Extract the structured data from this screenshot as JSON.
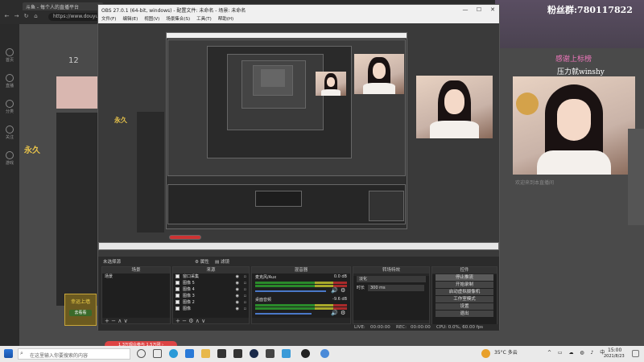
{
  "browser": {
    "tab_title": "斗鱼 - 每个人的直播平台",
    "address": "https://www.douyu.com"
  },
  "stream_page": {
    "fans_group": "粉丝群:780117822",
    "thanks_line": "感谢上标榜",
    "thanks_user": "压力就winshy",
    "viewer_count": "12",
    "left_badge": "永久",
    "left_rail": [
      "首页",
      "直播",
      "分类",
      "关注",
      "游戏"
    ],
    "sticker_label": "幸运上墙",
    "sticker_button": "去看看",
    "bottom_pill": "1.3万观众参与  1.5万团 ›",
    "side_note": "欢迎来到本直播间"
  },
  "obs": {
    "title": "OBS 27.0.1 (64-bit, windows) - 配置文件: 未命名 - 场景: 未命名",
    "window_controls": [
      "—",
      "☐",
      "✕"
    ],
    "menu": [
      "文件(F)",
      "编辑(E)",
      "视图(V)",
      "场景集合(S)",
      "工具(T)",
      "帮助(H)"
    ],
    "scene_bar": {
      "label": "未选择源",
      "properties": "属性",
      "filters": "滤镜"
    },
    "docks": {
      "scenes": {
        "title": "场景",
        "items": [
          "场景"
        ]
      },
      "sources": {
        "title": "来源",
        "items": [
          "窗口采集",
          "图像 5",
          "图像 4",
          "图像 3",
          "图像 2",
          "图像"
        ]
      },
      "mixer": {
        "title": "混音器",
        "tracks": [
          {
            "name": "麦克风/Aux",
            "db": "0.0 dB"
          },
          {
            "name": "桌面音频",
            "db": "-9.6 dB"
          }
        ]
      },
      "transitions": {
        "title": "转场特效",
        "type": "淡化",
        "duration_label": "时长",
        "duration": "300 ms"
      },
      "controls": {
        "title": "控件",
        "buttons": [
          "停止推流",
          "开始录制",
          "启动虚拟摄像机",
          "工作室模式",
          "设置",
          "退出"
        ]
      }
    },
    "status": {
      "live": "LIVE:",
      "live_time": "00:00:00",
      "rec": "REC:",
      "rec_time": "00:00:00",
      "cpu": "CPU: 0.0%, 60.00 fps"
    }
  },
  "taskbar": {
    "search_placeholder": "在这里输入你要搜索的内容",
    "weather": "35°C 多云",
    "time": "15:00",
    "date": "2021/8/23"
  },
  "icons": [
    "windows-start-icon",
    "search-icon",
    "task-view-icon",
    "edge-icon",
    "file-explorer-icon",
    "steam-icon",
    "obs-icon",
    "browser-icon",
    "mail-icon"
  ],
  "colors": {
    "obs_bg": "#2b2b2b",
    "meter_green": "#2a8a2a",
    "accent_gold": "#e8c34a",
    "taskbar": "#eaeaea"
  }
}
